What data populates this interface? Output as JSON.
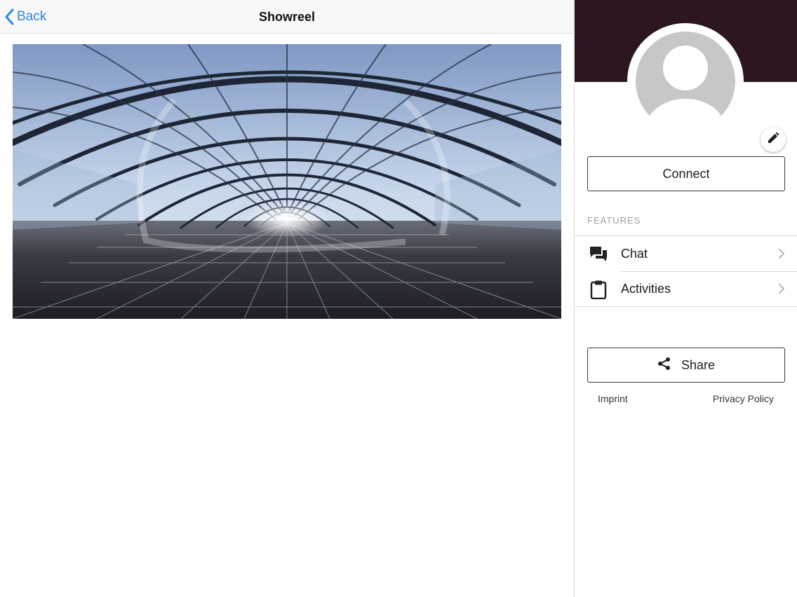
{
  "colors": {
    "accent": "#2e86de",
    "profile_header": "#2b1622",
    "avatar_bg": "#c7c7c7"
  },
  "nav": {
    "back_label": "Back",
    "back_icon": "chevron-left-icon",
    "title": "Showreel"
  },
  "media": {
    "kind": "360-panorama-image"
  },
  "profile": {
    "avatar_icon": "person-placeholder-icon",
    "edit_icon": "pencil-icon"
  },
  "actions": {
    "connect_label": "Connect",
    "share_label": "Share",
    "share_icon": "share-icon"
  },
  "features": {
    "heading": "FEATURES",
    "items": [
      {
        "label": "Chat",
        "icon": "chat-icon"
      },
      {
        "label": "Activities",
        "icon": "clipboard-icon"
      }
    ]
  },
  "footer": {
    "imprint_label": "Imprint",
    "privacy_label": "Privacy Policy"
  }
}
